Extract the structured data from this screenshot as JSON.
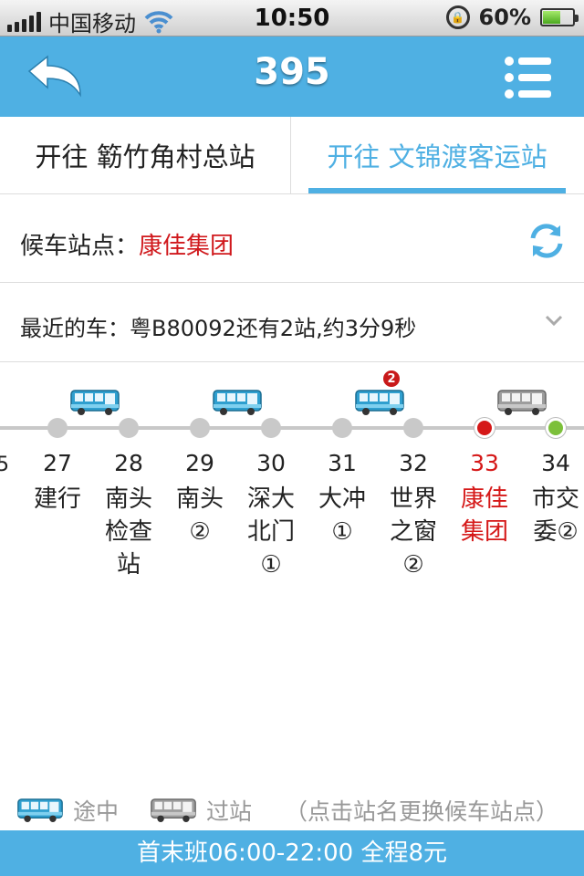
{
  "status_bar": {
    "carrier": "中国移动",
    "time": "10:50",
    "battery": "60%",
    "battery_level": 0.6
  },
  "nav": {
    "title": "395",
    "icons": [
      "back-arrow-icon",
      "menu-list-icon"
    ]
  },
  "tabs": [
    {
      "label": "开往 簕竹角村总站",
      "selected": false
    },
    {
      "label": "开往 文锦渡客运站",
      "selected": true
    }
  ],
  "waiting_station": {
    "label": "候车站点：",
    "value": "康佳集团"
  },
  "nearest_bus": {
    "text": "最近的车：粤B80092还有2站,约3分9秒"
  },
  "route": {
    "edge_mark": "5",
    "stops": [
      {
        "num": "27",
        "name": "建行"
      },
      {
        "num": "28",
        "name": "南头检查站"
      },
      {
        "num": "29",
        "name": "南头②"
      },
      {
        "num": "30",
        "name": "深大北门①"
      },
      {
        "num": "31",
        "name": "大冲①"
      },
      {
        "num": "32",
        "name": "世界之窗②"
      },
      {
        "num": "33",
        "name": "康佳集团"
      },
      {
        "num": "34",
        "name": "市交委②"
      }
    ],
    "buses": [
      {
        "status": "en-route"
      },
      {
        "status": "en-route"
      },
      {
        "status": "en-route",
        "badge": "2"
      },
      {
        "status": "at-stop"
      }
    ]
  },
  "legend": {
    "enroute": "途中",
    "passing": "过站",
    "hint": "（点击站名更换候车站点）"
  },
  "footer": {
    "text": "首末班06:00-22:00 全程8元"
  },
  "colors": {
    "accent": "#4fb0e3",
    "highlight": "#d51818",
    "next_stop": "#7cc03a"
  }
}
